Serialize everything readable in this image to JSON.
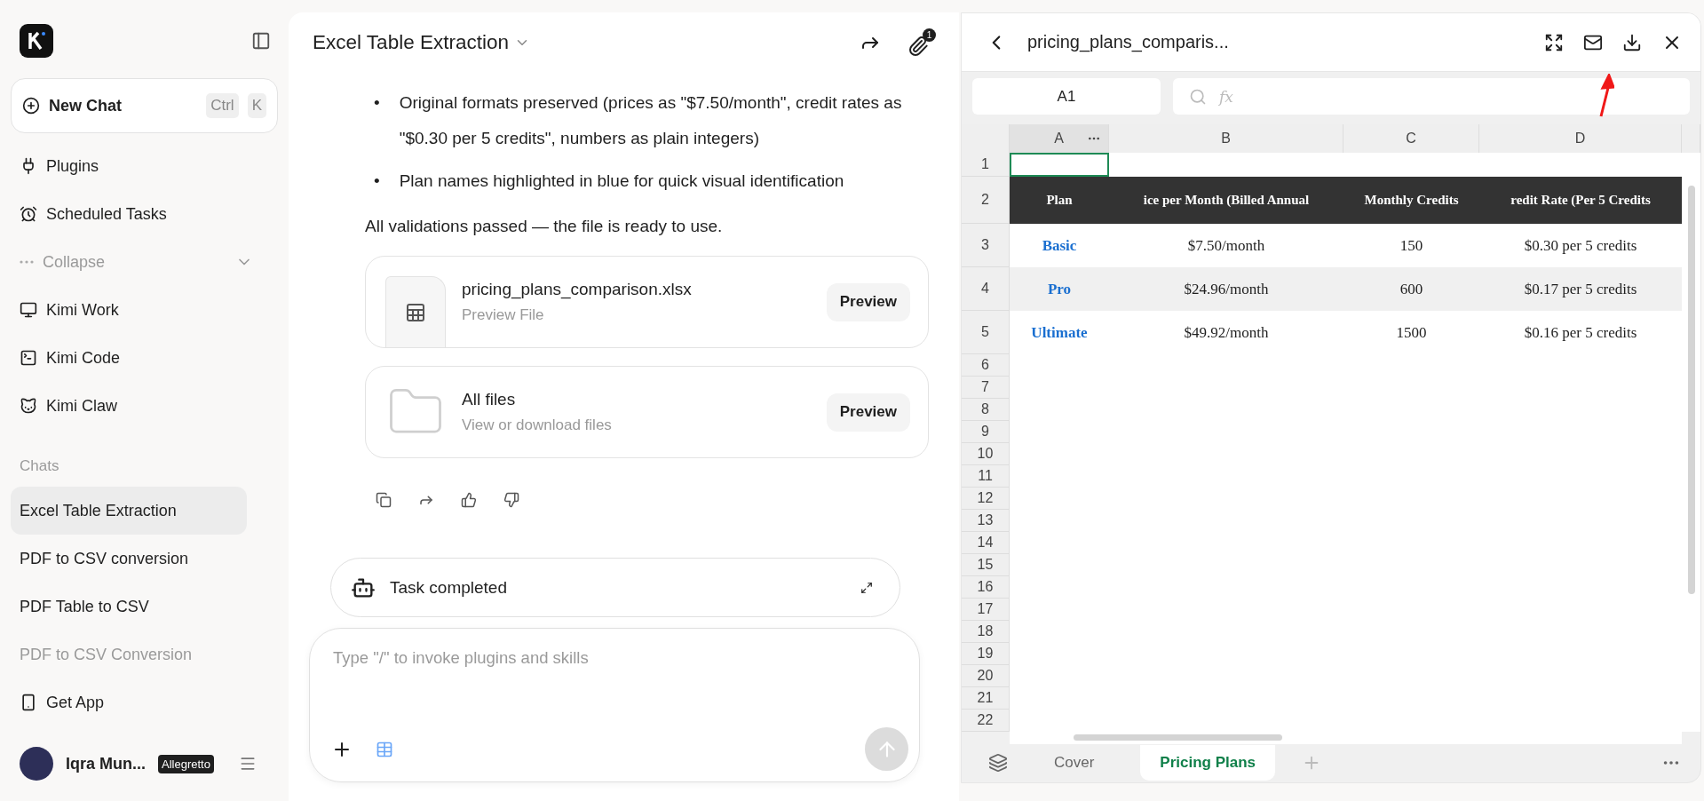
{
  "sidebar": {
    "new_chat": {
      "label": "New Chat",
      "shortcut": [
        "Ctrl",
        "K"
      ]
    },
    "nav": [
      {
        "label": "Plugins",
        "kind": "plug"
      },
      {
        "label": "Scheduled Tasks",
        "kind": "alarm"
      }
    ],
    "collapse": {
      "label": "Collapse",
      "expanded": true
    },
    "apps": [
      {
        "label": "Kimi Work",
        "kind": "monitor"
      },
      {
        "label": "Kimi Code",
        "kind": "terminal"
      },
      {
        "label": "Kimi Claw",
        "kind": "claw"
      }
    ],
    "chats_heading": "Chats",
    "chats": [
      {
        "label": "Excel Table Extraction",
        "selected": true,
        "faded": false
      },
      {
        "label": "PDF to CSV conversion",
        "selected": false,
        "faded": false
      },
      {
        "label": "PDF Table to CSV",
        "selected": false,
        "faded": false
      },
      {
        "label": "PDF to CSV Conversion",
        "selected": false,
        "faded": true
      }
    ],
    "get_app": "Get App",
    "user": {
      "name": "Iqra Mun...",
      "badge": "Allegretto"
    }
  },
  "chat": {
    "title": "Excel Table Extraction",
    "attachment_count": "1",
    "bullet_marker": "•",
    "bullets": [
      "Original formats preserved (prices as \"$7.50/month\", credit rates as \"$0.30 per 5 credits\", numbers as plain integers)",
      "Plan names highlighted in blue for quick visual identification"
    ],
    "summary": "All validations passed — the file is ready to use.",
    "files": [
      {
        "kind": "sheet",
        "name": "pricing_plans_comparison.xlsx",
        "subtitle": "Preview File",
        "action": "Preview"
      },
      {
        "kind": "folder",
        "name": "All files",
        "subtitle": "View or download files",
        "action": "Preview"
      }
    ],
    "task": "Task completed",
    "input": {
      "placeholder": "Type \"/\" to invoke plugins and skills"
    }
  },
  "sheet": {
    "title": "pricing_plans_comparis...",
    "cell_ref": "A1",
    "function_label": "fx",
    "columns": [
      "A",
      "B",
      "C",
      "D"
    ],
    "header": [
      "Plan",
      "ice per Month (Billed Annual",
      "Monthly Credits",
      "redit Rate (Per 5 Credits"
    ],
    "rows": [
      {
        "cells": [
          "Basic",
          "$7.50/month",
          "150",
          "$0.30 per 5 credits"
        ],
        "shaded": false
      },
      {
        "cells": [
          "Pro",
          "$24.96/month",
          "600",
          "$0.17 per 5 credits"
        ],
        "shaded": true
      },
      {
        "cells": [
          "Ultimate",
          "$49.92/month",
          "1500",
          "$0.16 per 5 credits"
        ],
        "shaded": false
      }
    ],
    "row_numbers": [
      "1",
      "2",
      "3",
      "4",
      "5",
      "6",
      "7",
      "8",
      "9",
      "10",
      "11",
      "12",
      "13",
      "14",
      "15",
      "16",
      "17",
      "18",
      "19",
      "20",
      "21",
      "22"
    ],
    "tabs": [
      {
        "label": "Cover",
        "selected": false
      },
      {
        "label": "Pricing Plans",
        "selected": true
      }
    ]
  }
}
